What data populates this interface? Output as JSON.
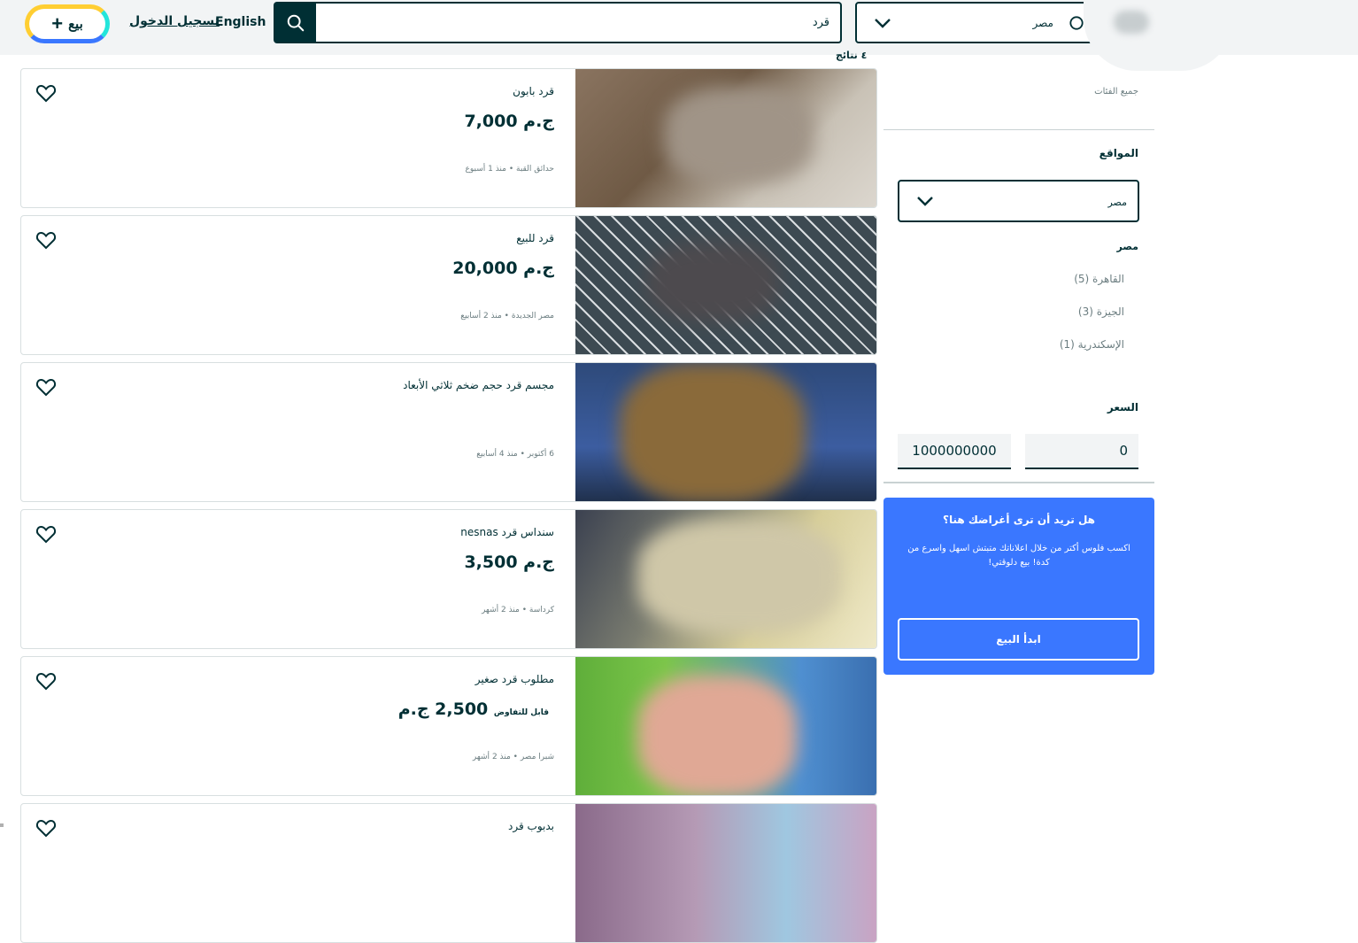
{
  "header": {
    "sell_label": "بيع",
    "login_label": "تسجيل الدخول",
    "language_label": "English",
    "search_value": "قرد",
    "location_value": "مصر"
  },
  "partial_heading": "٤ نتائج",
  "listings": [
    {
      "title": "قرد بابون",
      "price": "7,000 ج.م",
      "negotiable": "",
      "meta": "حدائق القبة • منذ 1 أسبوع"
    },
    {
      "title": "قرد للبيع",
      "price": "20,000 ج.م",
      "negotiable": "",
      "meta": "مصر الجديدة • منذ 2 أسابيع"
    },
    {
      "title": "مجسم قرد حجم ضخم ثلاثي الأبعاد",
      "price": "",
      "negotiable": "",
      "meta": "6 أكتوبر • منذ 4 أسابيع"
    },
    {
      "title": "سنداس قرد nesnas",
      "price": "3,500 ج.م",
      "negotiable": "",
      "meta": "كرداسة • منذ 2 أشهر"
    },
    {
      "title": "مطلوب قرد صغير",
      "price": "2,500 ج.م",
      "negotiable": "قابل للتفاوض",
      "meta": "شبرا مصر • منذ 2 أشهر"
    },
    {
      "title": "بدبوب قرد",
      "price": "",
      "negotiable": "",
      "meta": ""
    }
  ],
  "sidebar": {
    "all_categories": "جميع الفئات",
    "locations_heading": "المواقع",
    "location_select": "مصر",
    "region_title": "مصر",
    "regions": [
      "القاهرة (5)",
      "الجيزة (3)",
      "الإسكندرية (1)"
    ],
    "price_heading": "السعر",
    "price_min": "0",
    "price_max": "1000000000",
    "promo_title": "هل تريد أن ترى أغراضك هنا؟",
    "promo_body": "اكسب فلوس أكتر من خلال اعلاناتك متبتش اسهل واسرع من كدة! بيع دلوقتي!",
    "promo_button": "ابدأ البيع"
  },
  "icons": [
    "plus-icon",
    "search-icon",
    "chevron-down-icon",
    "heart-icon"
  ],
  "colors": {
    "primary": "#002f34",
    "accent_blue": "#3a77ff",
    "accent_teal": "#23e5db",
    "accent_yellow": "#ffce32"
  }
}
